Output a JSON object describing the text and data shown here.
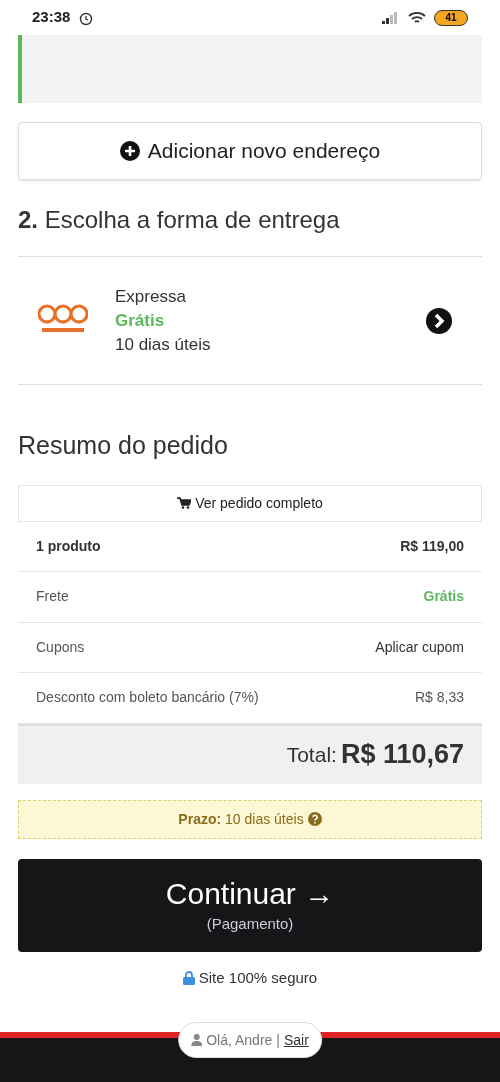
{
  "status_bar": {
    "time": "23:38",
    "battery": "41"
  },
  "add_address": {
    "label": "Adicionar novo endereço"
  },
  "delivery": {
    "number": "2.",
    "title": "Escolha a forma de entrega",
    "options": [
      {
        "name": "Expressa",
        "price": "Grátis",
        "time": "10 dias úteis"
      }
    ]
  },
  "summary": {
    "title": "Resumo do pedido",
    "view_order": "Ver pedido completo",
    "rows": [
      {
        "kind": "bold",
        "label": "1 produto",
        "value": "R$ 119,00"
      },
      {
        "kind": "green",
        "label": "Frete",
        "value": "Grátis"
      },
      {
        "kind": "link",
        "label": "Cupons",
        "value": "Aplicar cupom"
      },
      {
        "kind": "plain",
        "label": "Desconto com boleto bancário (7%)",
        "value": "R$ 8,33"
      }
    ],
    "total_label": "Total:",
    "total_value": "R$ 110,67"
  },
  "deadline": {
    "label": "Prazo:",
    "value": "10 dias úteis"
  },
  "continue_button": {
    "label": "Continuar →",
    "sub": "(Pagamento)"
  },
  "secure": "Site 100% seguro",
  "footer": {
    "greeting": "Olá, Andre |",
    "logout": "Sair"
  }
}
